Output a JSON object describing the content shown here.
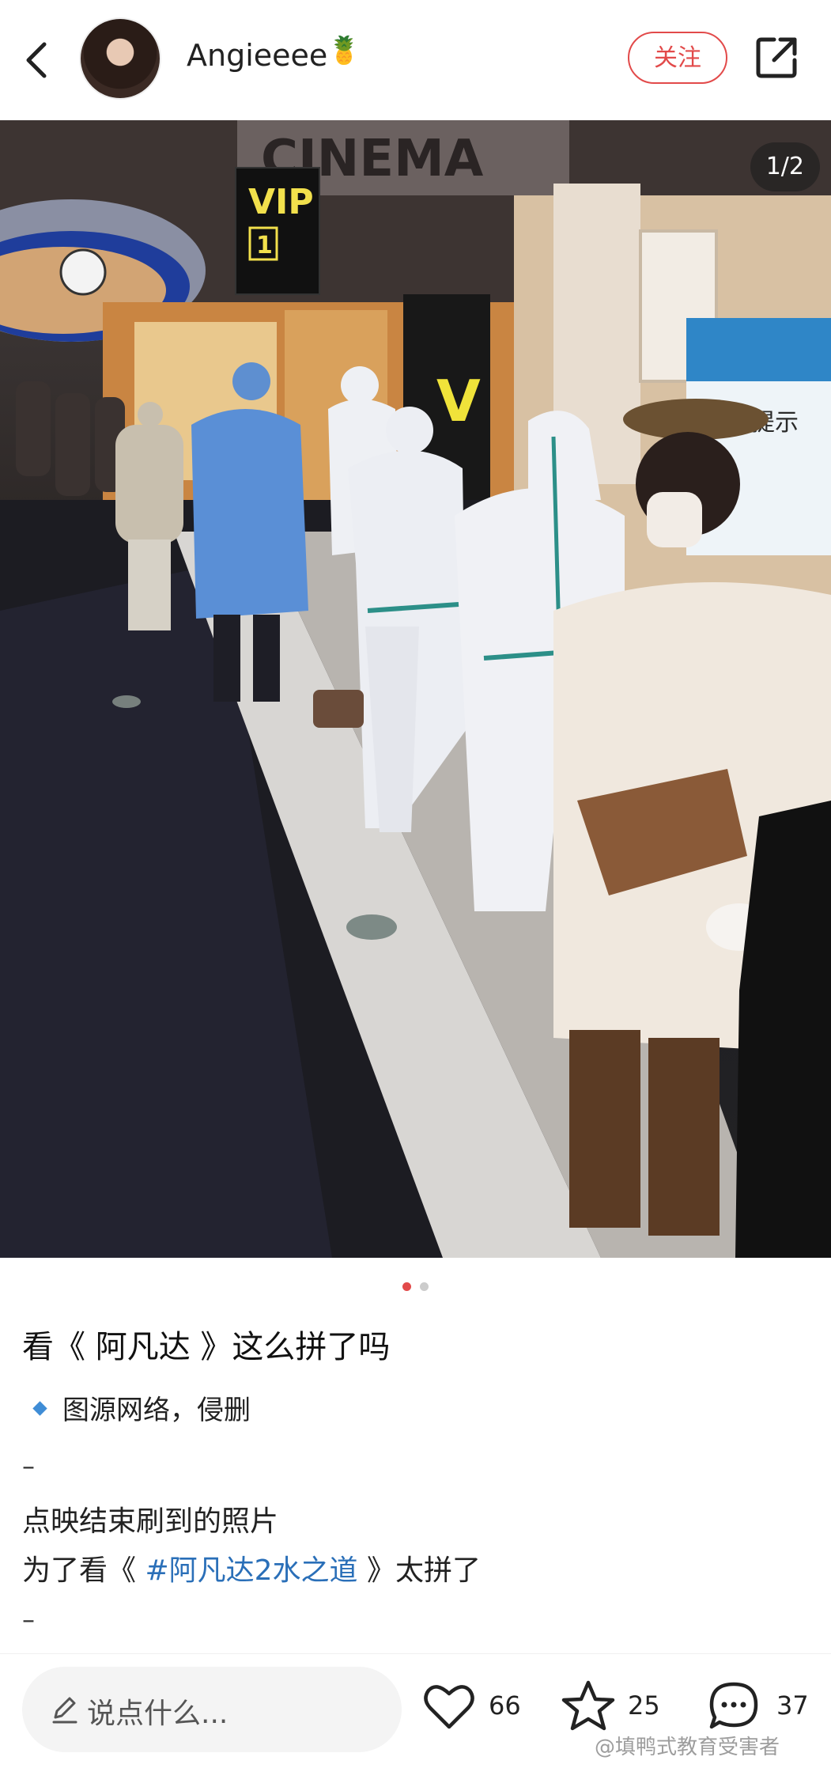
{
  "header": {
    "username": "Angieeee",
    "username_emoji": "🍍",
    "follow_label": "关注"
  },
  "photo": {
    "counter": "1/2",
    "signs": {
      "vip_text": "VIP",
      "vip_number": "1",
      "cinema_text": "CINEMA",
      "neon_letter": "V",
      "safety_notice": "安全提示"
    }
  },
  "pagination": {
    "active_index": 0,
    "total": 2
  },
  "post": {
    "title": "看《 阿凡达 》这么拼了吗",
    "source_note": "图源网络，侵删",
    "divider_1": "–",
    "line_1": "点映结束刷到的照片",
    "line_2_prefix": "为了看《 ",
    "line_2_tag": "#阿凡达2水之道",
    "line_2_suffix": " 》太拼了",
    "divider_2": "–"
  },
  "bottom_bar": {
    "comment_placeholder": "说点什么...",
    "likes": "66",
    "favorites": "25",
    "comments": "37"
  },
  "watermark": "@填鸭式教育受害者",
  "colors": {
    "accent_red": "#e24a4a",
    "tag_blue": "#2a6fb8",
    "bullet_blue": "#3f8dd6"
  }
}
